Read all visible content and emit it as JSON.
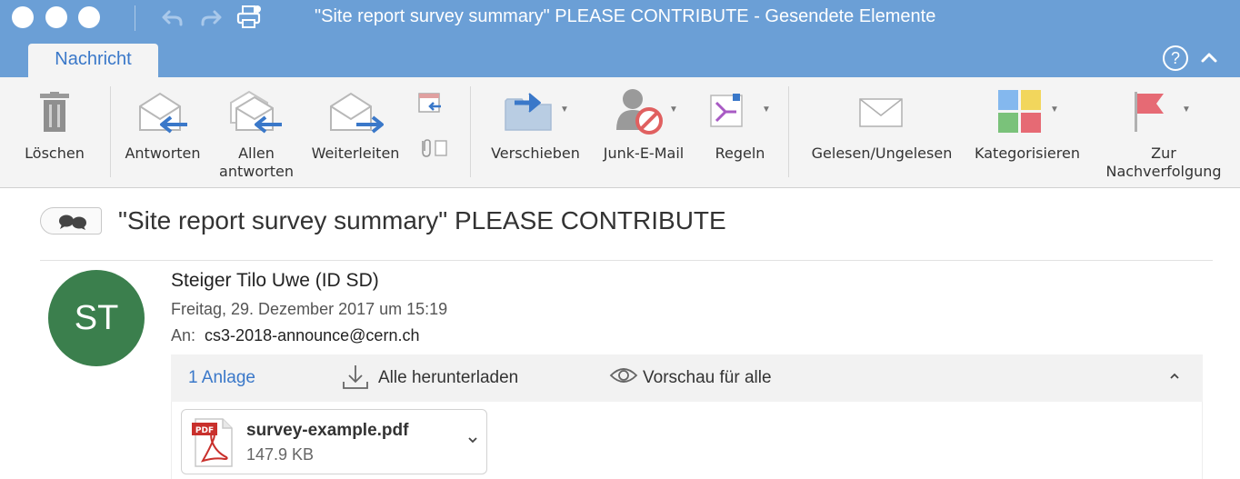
{
  "window": {
    "title": "\"Site report survey summary\" PLEASE CONTRIBUTE - Gesendete Elemente",
    "toolbar_icons": [
      "undo-icon",
      "redo-icon",
      "print-icon"
    ]
  },
  "ribbon": {
    "active_tab": "Nachricht",
    "help_label": "?",
    "buttons": {
      "delete": "Löschen",
      "reply": "Antworten",
      "reply_all_line1": "Allen",
      "reply_all_line2": "antworten",
      "forward": "Weiterleiten",
      "move": "Verschieben",
      "junk": "Junk-E-Mail",
      "rules": "Regeln",
      "read_unread": "Gelesen/Ungelesen",
      "categorize": "Kategorisieren",
      "followup_line1": "Zur",
      "followup_line2": "Nachverfolgung"
    }
  },
  "message": {
    "subject": "\"Site report survey summary\" PLEASE CONTRIBUTE",
    "avatar_initials": "ST",
    "avatar_color": "#3b7f4d",
    "sender": "Steiger  Tilo Uwe (ID SD)",
    "date": "Freitag, 29. Dezember 2017 um 15:19",
    "to_label": "An:",
    "to_address": "cs3-2018-announce@cern.ch"
  },
  "attachments": {
    "count_label": "1 Anlage",
    "download_all": "Alle herunterladen",
    "preview_all": "Vorschau für alle",
    "files": [
      {
        "name": "survey-example.pdf",
        "size": "147.9 KB",
        "icon": "pdf-file-icon",
        "badge": "PDF"
      }
    ]
  },
  "colors": {
    "accent": "#6b9fd6",
    "link": "#3a78c9",
    "flag": "#e66a74"
  }
}
